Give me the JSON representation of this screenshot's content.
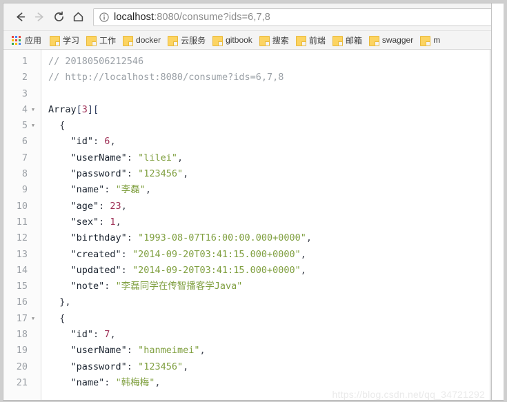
{
  "browser": {
    "nav": {
      "back_label": "Back",
      "forward_label": "Forward",
      "reload_label": "Reload",
      "home_label": "Home"
    },
    "omnibox": {
      "info_icon": "info-circle-icon",
      "url_full": "localhost:8080/consume?ids=6,7,8",
      "url_host": "localhost",
      "url_rest": ":8080/consume?ids=6,7,8"
    },
    "bookmarks": {
      "apps_label": "应用",
      "items": [
        {
          "label": "学习"
        },
        {
          "label": "工作"
        },
        {
          "label": "docker"
        },
        {
          "label": "云服务"
        },
        {
          "label": "gitbook"
        },
        {
          "label": "搜索"
        },
        {
          "label": "前端"
        },
        {
          "label": "邮箱"
        },
        {
          "label": "swagger"
        },
        {
          "label": "m"
        }
      ]
    }
  },
  "viewer": {
    "watermark": "https://blog.csdn.net/qq_34721292",
    "lines": [
      {
        "n": "1",
        "fold": "",
        "indent": 0,
        "tokens": [
          {
            "t": "comment",
            "v": "// 20180506212546"
          }
        ]
      },
      {
        "n": "2",
        "fold": "",
        "indent": 0,
        "tokens": [
          {
            "t": "comment",
            "v": "// http://localhost:8080/consume?ids=6,7,8"
          }
        ]
      },
      {
        "n": "3",
        "fold": "",
        "indent": 0,
        "tokens": []
      },
      {
        "n": "4",
        "fold": "▼",
        "indent": 0,
        "tokens": [
          {
            "t": "plain",
            "v": "Array"
          },
          {
            "t": "brk",
            "v": "["
          },
          {
            "t": "num",
            "v": "3"
          },
          {
            "t": "brk",
            "v": "]["
          }
        ]
      },
      {
        "n": "5",
        "fold": "▼",
        "indent": 1,
        "tokens": [
          {
            "t": "punct",
            "v": "{"
          }
        ]
      },
      {
        "n": "6",
        "fold": "",
        "indent": 2,
        "tokens": [
          {
            "t": "key",
            "v": "\"id\""
          },
          {
            "t": "punct",
            "v": ": "
          },
          {
            "t": "num",
            "v": "6"
          },
          {
            "t": "punct",
            "v": ","
          }
        ]
      },
      {
        "n": "7",
        "fold": "",
        "indent": 2,
        "tokens": [
          {
            "t": "key",
            "v": "\"userName\""
          },
          {
            "t": "punct",
            "v": ": "
          },
          {
            "t": "str",
            "v": "\"lilei\""
          },
          {
            "t": "punct",
            "v": ","
          }
        ]
      },
      {
        "n": "8",
        "fold": "",
        "indent": 2,
        "tokens": [
          {
            "t": "key",
            "v": "\"password\""
          },
          {
            "t": "punct",
            "v": ": "
          },
          {
            "t": "str",
            "v": "\"123456\""
          },
          {
            "t": "punct",
            "v": ","
          }
        ]
      },
      {
        "n": "9",
        "fold": "",
        "indent": 2,
        "tokens": [
          {
            "t": "key",
            "v": "\"name\""
          },
          {
            "t": "punct",
            "v": ": "
          },
          {
            "t": "str",
            "v": "\"李磊\""
          },
          {
            "t": "punct",
            "v": ","
          }
        ]
      },
      {
        "n": "10",
        "fold": "",
        "indent": 2,
        "tokens": [
          {
            "t": "key",
            "v": "\"age\""
          },
          {
            "t": "punct",
            "v": ": "
          },
          {
            "t": "num",
            "v": "23"
          },
          {
            "t": "punct",
            "v": ","
          }
        ]
      },
      {
        "n": "11",
        "fold": "",
        "indent": 2,
        "tokens": [
          {
            "t": "key",
            "v": "\"sex\""
          },
          {
            "t": "punct",
            "v": ": "
          },
          {
            "t": "num",
            "v": "1"
          },
          {
            "t": "punct",
            "v": ","
          }
        ]
      },
      {
        "n": "12",
        "fold": "",
        "indent": 2,
        "tokens": [
          {
            "t": "key",
            "v": "\"birthday\""
          },
          {
            "t": "punct",
            "v": ": "
          },
          {
            "t": "str",
            "v": "\"1993-08-07T16:00:00.000+0000\""
          },
          {
            "t": "punct",
            "v": ","
          }
        ]
      },
      {
        "n": "13",
        "fold": "",
        "indent": 2,
        "tokens": [
          {
            "t": "key",
            "v": "\"created\""
          },
          {
            "t": "punct",
            "v": ": "
          },
          {
            "t": "str",
            "v": "\"2014-09-20T03:41:15.000+0000\""
          },
          {
            "t": "punct",
            "v": ","
          }
        ]
      },
      {
        "n": "14",
        "fold": "",
        "indent": 2,
        "tokens": [
          {
            "t": "key",
            "v": "\"updated\""
          },
          {
            "t": "punct",
            "v": ": "
          },
          {
            "t": "str",
            "v": "\"2014-09-20T03:41:15.000+0000\""
          },
          {
            "t": "punct",
            "v": ","
          }
        ]
      },
      {
        "n": "15",
        "fold": "",
        "indent": 2,
        "tokens": [
          {
            "t": "key",
            "v": "\"note\""
          },
          {
            "t": "punct",
            "v": ": "
          },
          {
            "t": "str",
            "v": "\"李磊同学在传智播客学Java\""
          }
        ]
      },
      {
        "n": "16",
        "fold": "",
        "indent": 1,
        "tokens": [
          {
            "t": "punct",
            "v": "},"
          }
        ]
      },
      {
        "n": "17",
        "fold": "▼",
        "indent": 1,
        "tokens": [
          {
            "t": "punct",
            "v": "{"
          }
        ]
      },
      {
        "n": "18",
        "fold": "",
        "indent": 2,
        "tokens": [
          {
            "t": "key",
            "v": "\"id\""
          },
          {
            "t": "punct",
            "v": ": "
          },
          {
            "t": "num",
            "v": "7"
          },
          {
            "t": "punct",
            "v": ","
          }
        ]
      },
      {
        "n": "19",
        "fold": "",
        "indent": 2,
        "tokens": [
          {
            "t": "key",
            "v": "\"userName\""
          },
          {
            "t": "punct",
            "v": ": "
          },
          {
            "t": "str",
            "v": "\"hanmeimei\""
          },
          {
            "t": "punct",
            "v": ","
          }
        ]
      },
      {
        "n": "20",
        "fold": "",
        "indent": 2,
        "tokens": [
          {
            "t": "key",
            "v": "\"password\""
          },
          {
            "t": "punct",
            "v": ": "
          },
          {
            "t": "str",
            "v": "\"123456\""
          },
          {
            "t": "punct",
            "v": ","
          }
        ]
      },
      {
        "n": "21",
        "fold": "",
        "indent": 2,
        "tokens": [
          {
            "t": "key",
            "v": "\"name\""
          },
          {
            "t": "punct",
            "v": ": "
          },
          {
            "t": "str",
            "v": "\"韩梅梅\""
          },
          {
            "t": "punct",
            "v": ","
          }
        ]
      }
    ]
  }
}
